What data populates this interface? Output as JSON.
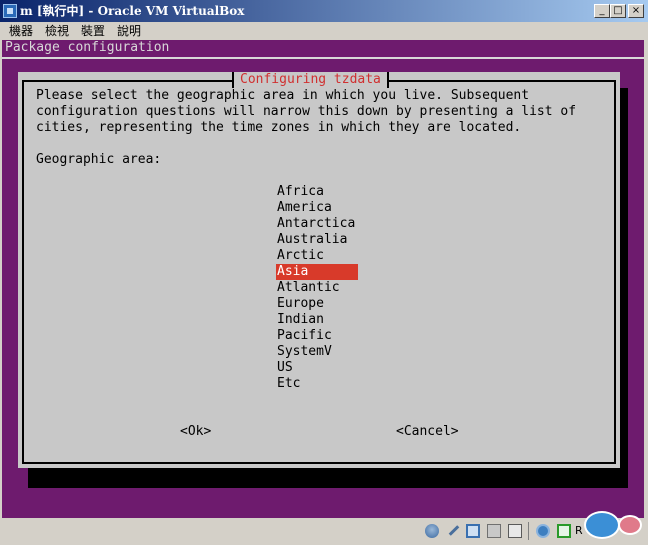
{
  "window": {
    "title": "m [執行中] - Oracle VM VirtualBox",
    "minimize_glyph": "_",
    "maximize_glyph": "□",
    "close_glyph": "×"
  },
  "menubar": {
    "items": [
      "機器",
      "檢視",
      "裝置",
      "說明"
    ]
  },
  "installer": {
    "header": "Package configuration",
    "dialog_title": "Configuring tzdata",
    "description": "Please select the geographic area in which you live. Subsequent\nconfiguration questions will narrow this down by presenting a list of\ncities, representing the time zones in which they are located.",
    "area_label": "Geographic area:",
    "areas": [
      "Africa",
      "America",
      "Antarctica",
      "Australia",
      "Arctic",
      "Asia",
      "Atlantic",
      "Europe",
      "Indian",
      "Pacific",
      "SystemV",
      "US",
      "Etc"
    ],
    "selected_area": "Asia",
    "ok_button": "<Ok>",
    "cancel_button": "<Cancel>"
  },
  "statusbar": {
    "host_key": "R",
    "icons": [
      "hard-disk-icon",
      "optical-drive-icon",
      "network-icon",
      "usb-icon",
      "shared-folder-icon",
      "mouse-capture-icon",
      "mouse-integration-icon"
    ]
  },
  "colors": {
    "screen_bg": "#6e1b6e",
    "dialog_bg": "#c8c8c8",
    "title_red": "#d03030",
    "selection_red": "#d83a2a"
  }
}
